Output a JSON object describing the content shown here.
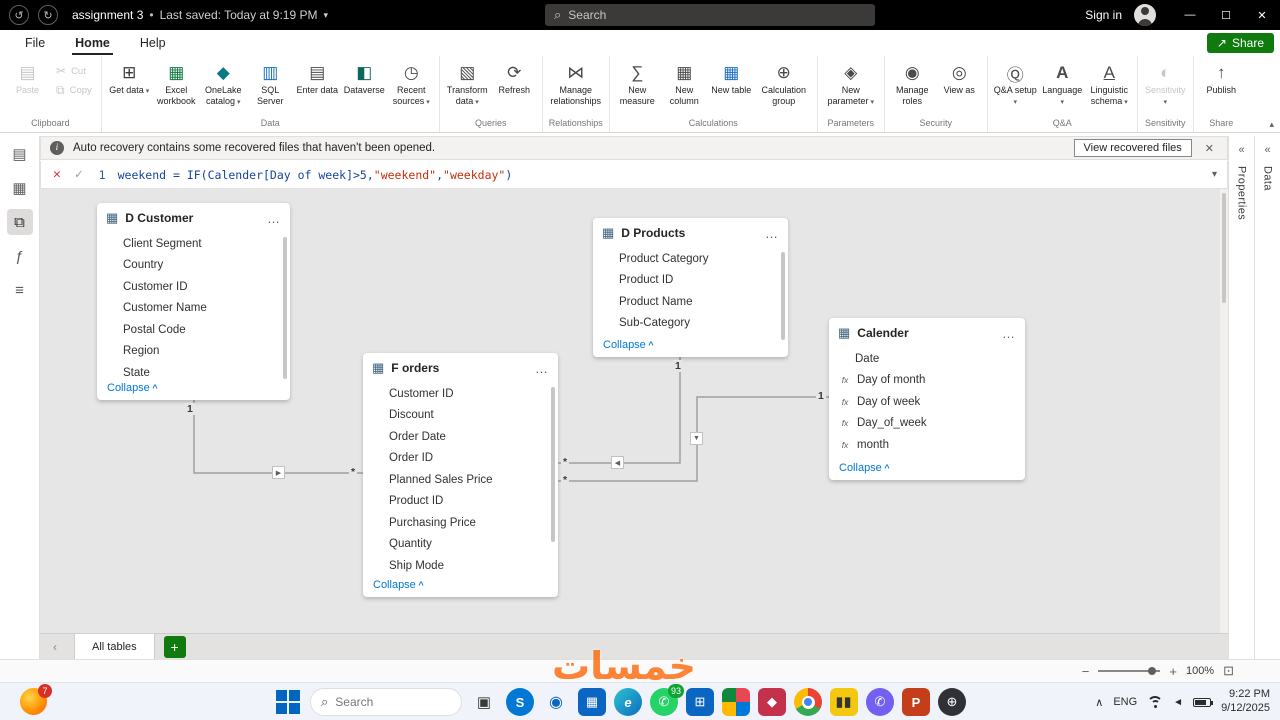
{
  "colors": {
    "accent_green": "#0f7b0f",
    "titlebar_black": "#000000",
    "canvas_gray": "#e6e6e6",
    "link_blue": "#0078d4",
    "string_token": "#c72d0a"
  },
  "titlebar": {
    "undo_icon": "↺",
    "redo_icon": "↻",
    "title": "assignment 3",
    "separator": "•",
    "subtitle": "Last saved: Today at 9:19 PM",
    "caret": "▾",
    "search_icon": "⌕",
    "search_placeholder": "Search",
    "sign_in": "Sign in",
    "minimize_icon": "—",
    "maximize_icon": "☐",
    "close_icon": "✕"
  },
  "menubar": {
    "file": "File",
    "home": "Home",
    "help": "Help",
    "share_icon": "↗",
    "share": "Share"
  },
  "ribbon": {
    "collapse_icon": "▴",
    "groups": [
      {
        "label": "Clipboard",
        "buttons": [
          {
            "label": "Paste",
            "icon": "▤"
          },
          {
            "label": "Cut",
            "icon": "✂"
          },
          {
            "label": "Copy",
            "icon": "⧉"
          }
        ]
      },
      {
        "label": "Data",
        "buttons": [
          {
            "label": "Get data",
            "icon": "⊞"
          },
          {
            "label": "Excel workbook",
            "icon": "▦"
          },
          {
            "label": "OneLake catalog",
            "icon": "◆"
          },
          {
            "label": "SQL Server",
            "icon": "▥"
          },
          {
            "label": "Enter data",
            "icon": "▤"
          },
          {
            "label": "Dataverse",
            "icon": "◧"
          },
          {
            "label": "Recent sources",
            "icon": "◷"
          }
        ]
      },
      {
        "label": "Queries",
        "buttons": [
          {
            "label": "Transform data",
            "icon": "▧"
          },
          {
            "label": "Refresh",
            "icon": "⟳"
          }
        ]
      },
      {
        "label": "Relationships",
        "buttons": [
          {
            "label": "Manage relationships",
            "icon": "⋈"
          }
        ]
      },
      {
        "label": "Calculations",
        "buttons": [
          {
            "label": "New measure",
            "icon": "∑"
          },
          {
            "label": "New column",
            "icon": "▦"
          },
          {
            "label": "New table",
            "icon": "▦"
          },
          {
            "label": "Calculation group",
            "icon": "⊕"
          }
        ]
      },
      {
        "label": "Parameters",
        "buttons": [
          {
            "label": "New parameter",
            "icon": "◈"
          }
        ]
      },
      {
        "label": "Security",
        "buttons": [
          {
            "label": "Manage roles",
            "icon": "◉"
          },
          {
            "label": "View as",
            "icon": "◎"
          }
        ]
      },
      {
        "label": "Q&A",
        "buttons": [
          {
            "label": "Q&A setup",
            "icon": "Ⓠ"
          },
          {
            "label": "Language",
            "icon": "A"
          },
          {
            "label": "Linguistic schema",
            "icon": "A"
          }
        ]
      },
      {
        "label": "Sensitivity",
        "buttons": [
          {
            "label": "Sensitivity",
            "icon": "◐"
          }
        ]
      },
      {
        "label": "Share",
        "buttons": [
          {
            "label": "Publish",
            "icon": "↑"
          }
        ]
      }
    ]
  },
  "notification": {
    "info_icon": "i",
    "text": "Auto recovery contains some recovered files that haven't been opened.",
    "action": "View recovered files",
    "close_icon": "✕"
  },
  "formula": {
    "cancel_icon": "✕",
    "accept_icon": "✓",
    "line_number": "1",
    "tokens": {
      "code1": "weekend = IF(Calender[Day of week]>5,",
      "str1": "\"weekend\"",
      "comma": ",",
      "str2": "\"weekday\"",
      "close": ")"
    },
    "caret_icon": "▾"
  },
  "views": {
    "report_icon": "▤",
    "data_icon": "▦",
    "model_icon": "⧉",
    "dax_icon": "ƒ",
    "tmdl_icon": "≡"
  },
  "panels": {
    "collapse_icon": "«",
    "properties": "Properties",
    "data": "Data"
  },
  "canvas": {
    "table_icon": "▦",
    "more_icon": "…",
    "collapse_label": "Collapse",
    "fx_icon": "fx",
    "tables": [
      {
        "title": "D Customer",
        "fields": [
          "Client Segment",
          "Country",
          "Customer ID",
          "Customer Name",
          "Postal Code",
          "Region",
          "State"
        ]
      },
      {
        "title": "F orders",
        "fields": [
          "Customer ID",
          "Discount",
          "Order Date",
          "Order ID",
          "Planned Sales Price",
          "Product ID",
          "Purchasing Price",
          "Quantity",
          "Ship Mode"
        ]
      },
      {
        "title": "D Products",
        "fields": [
          "Product Category",
          "Product ID",
          "Product Name",
          "Sub-Category"
        ]
      },
      {
        "title": "Calender",
        "fields": [
          "Date",
          "Day of month",
          "Day of week",
          "Day_of_week",
          "month"
        ]
      }
    ],
    "relationships": [
      {
        "one": "1",
        "many": "*",
        "arrow": "▶"
      },
      {
        "one": "1",
        "many": "*",
        "arrow": "◀"
      },
      {
        "one": "1",
        "many": "*",
        "arrow": "▼"
      }
    ]
  },
  "bottombar": {
    "scroll_icon": "‹",
    "tab": "All tables",
    "add_icon": "+"
  },
  "statusbar": {
    "zoom_out": "−",
    "zoom_in": "+",
    "zoom_level": "100%",
    "fit_icon": "⊡"
  },
  "watermark": "خمسات",
  "taskbar": {
    "firefox_badge": "7",
    "search_icon": "⌕",
    "search_placeholder": "Search",
    "apps": [
      {
        "name": "task-view",
        "glyph": "▣"
      },
      {
        "name": "skype",
        "glyph": "S"
      },
      {
        "name": "people",
        "glyph": "◉"
      },
      {
        "name": "calendar",
        "glyph": "▦"
      },
      {
        "name": "edge",
        "glyph": "e"
      },
      {
        "name": "whatsapp",
        "glyph": "✆",
        "badge": "93"
      },
      {
        "name": "store",
        "glyph": "⊞"
      },
      {
        "name": "photos",
        "glyph": ""
      },
      {
        "name": "security",
        "glyph": "◆"
      },
      {
        "name": "chrome",
        "glyph": ""
      },
      {
        "name": "power-bi",
        "glyph": "▮▮"
      },
      {
        "name": "viber",
        "glyph": "✆"
      },
      {
        "name": "powerpoint",
        "glyph": "P"
      },
      {
        "name": "globe",
        "glyph": "⊕"
      }
    ],
    "tray_chevron": "∧",
    "volume_icon": "◄",
    "lang": "ENG",
    "time": "9:22 PM",
    "date": "9/12/2025"
  }
}
